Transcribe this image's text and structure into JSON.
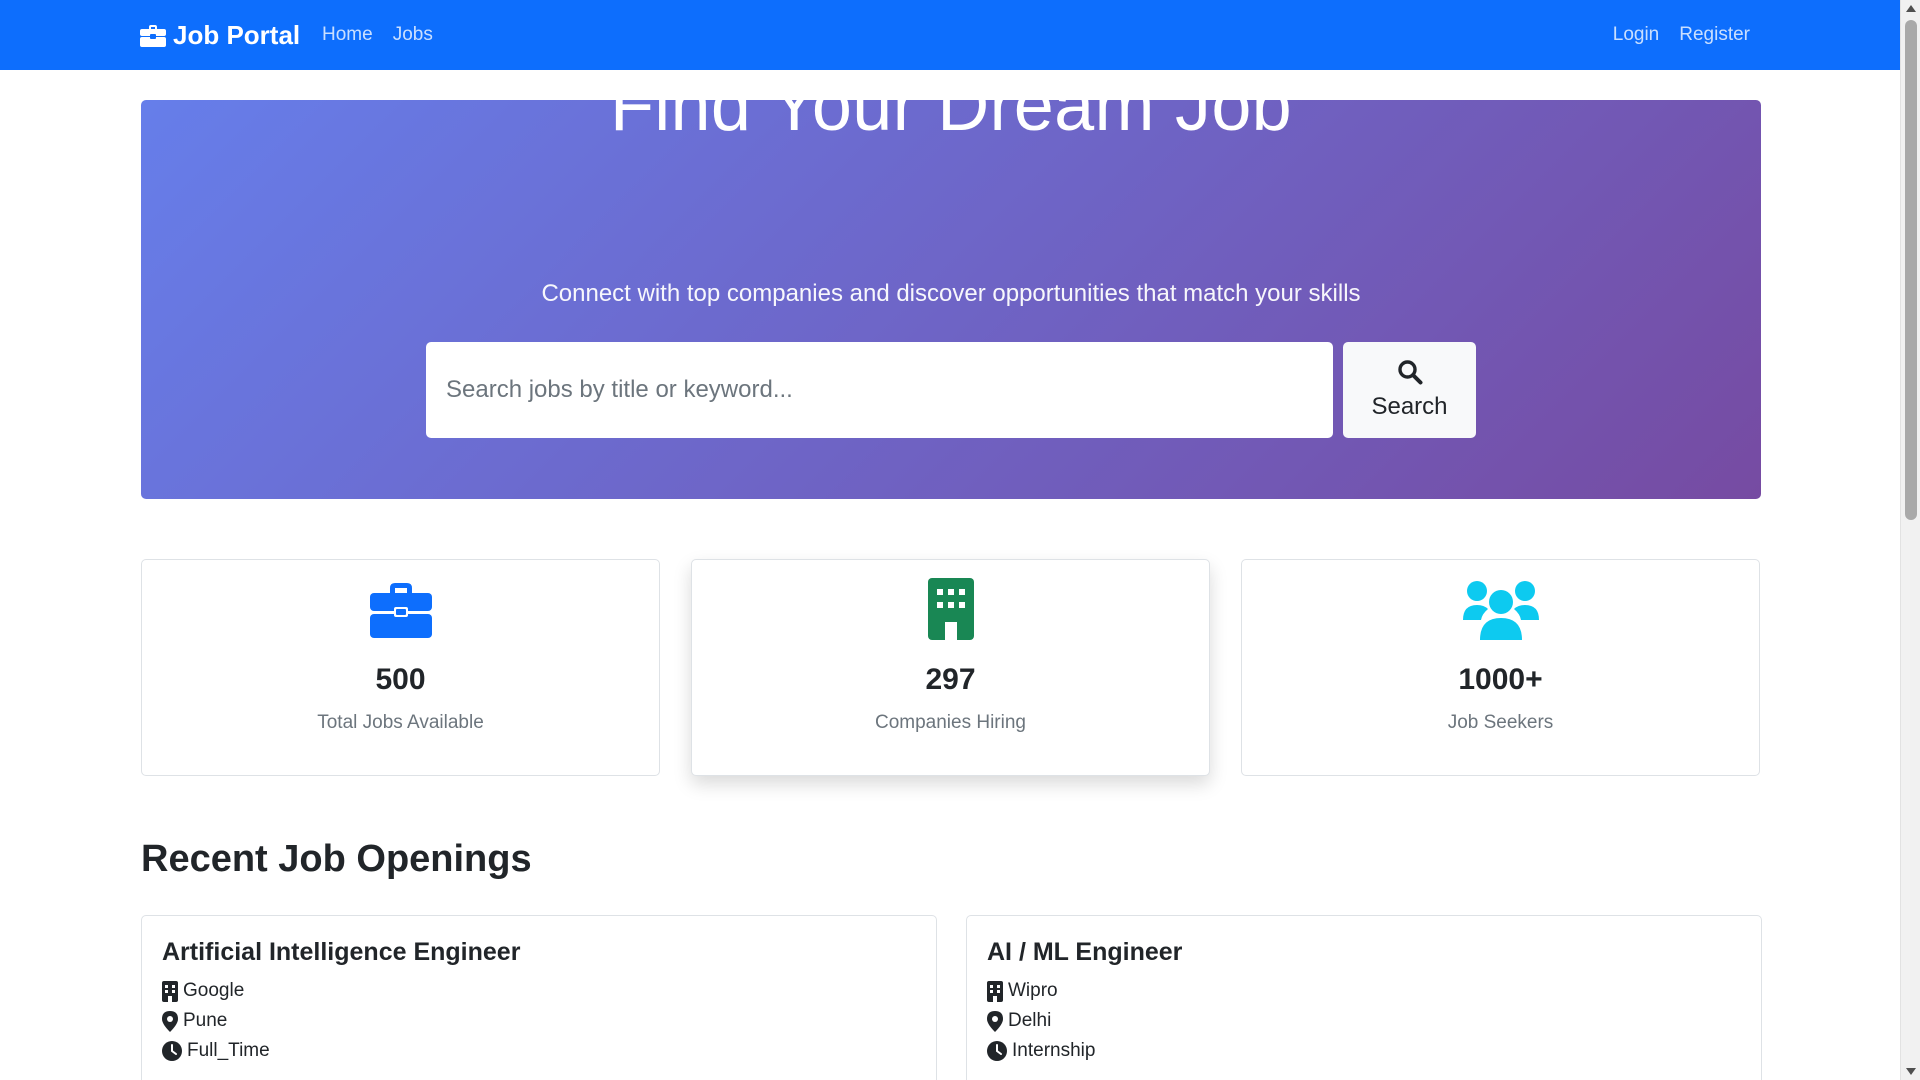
{
  "navbar": {
    "brand": "Job Portal",
    "links": [
      "Home",
      "Jobs"
    ],
    "auth": [
      "Login",
      "Register"
    ],
    "color": "#0d6efd"
  },
  "hero": {
    "title": "Find Your Dream Job",
    "subtitle": "Connect with top companies and discover opportunities that match your skills",
    "search_placeholder": "Search jobs by title or keyword...",
    "search_button": "Search",
    "gradient": [
      "#667eea",
      "#764ba2"
    ]
  },
  "stats": [
    {
      "icon": "briefcase-icon",
      "value": "500",
      "label": "Total Jobs Available",
      "color": "#0d6efd"
    },
    {
      "icon": "building-icon",
      "value": "297",
      "label": "Companies Hiring",
      "color": "#198754"
    },
    {
      "icon": "users-icon",
      "value": "1000+",
      "label": "Job Seekers",
      "color": "#0dcaf0"
    }
  ],
  "recent": {
    "title": "Recent Job Openings",
    "jobs": [
      {
        "title": "Artificial Intelligence Engineer",
        "company": "Google",
        "location": "Pune",
        "type": "Full_Time"
      },
      {
        "title": "AI / ML Engineer",
        "company": "Wipro",
        "location": "Delhi",
        "type": "Internship"
      }
    ]
  }
}
